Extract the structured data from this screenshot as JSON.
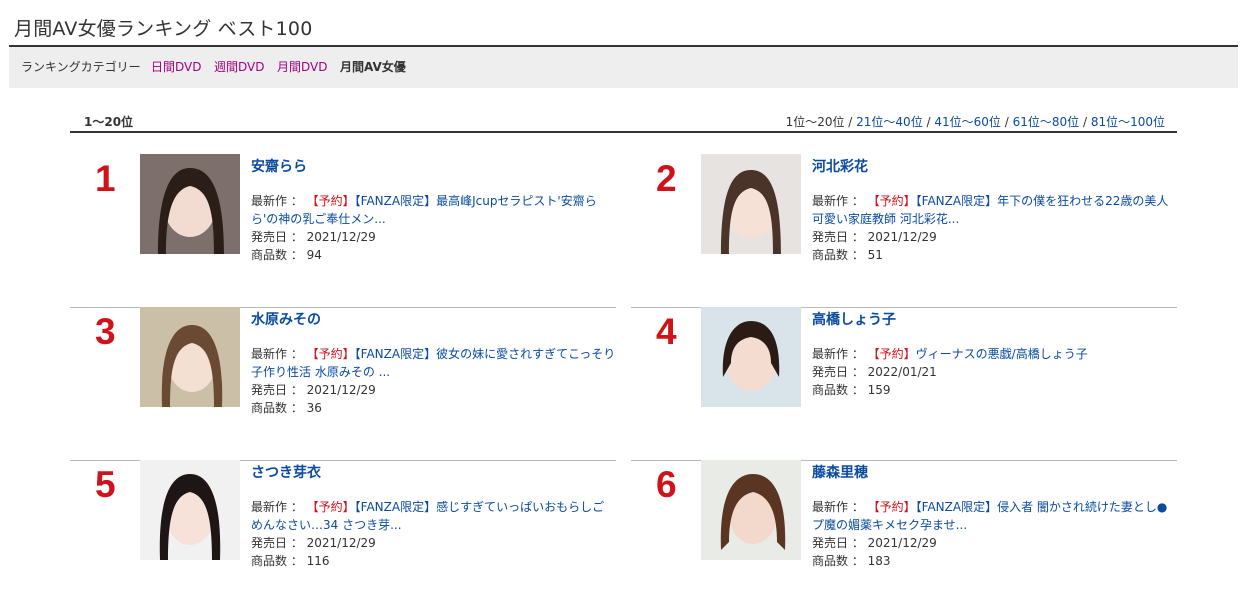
{
  "page": {
    "title": "月間AV女優ランキング ベスト100"
  },
  "categories": {
    "label": "ランキングカテゴリー",
    "links": [
      "日間DVD",
      "週間DVD",
      "月間DVD"
    ],
    "current": "月間AV女優"
  },
  "range": {
    "current": "1〜20位",
    "nav_current": "1位〜20位",
    "nav_links": [
      "21位〜40位",
      "41位〜60位",
      "61位〜80位",
      "81位〜100位"
    ],
    "separator": " / "
  },
  "labels": {
    "latest": "最新作 ： ",
    "release": "発売日 ： ",
    "count": "商品数 ： "
  },
  "ranking": [
    {
      "rank": "1",
      "name": "安齋らら",
      "reserve": "【予約】",
      "title": "【FANZA限定】最高峰Jcupセラピスト'安齋らら'の神の乳ご奉仕メン...",
      "release_date": "2021/12/29",
      "count": "94"
    },
    {
      "rank": "2",
      "name": "河北彩花",
      "reserve": "【予約】",
      "title": "【FANZA限定】年下の僕を狂わせる22歳の美人可愛い家庭教師 河北彩花...",
      "release_date": "2021/12/29",
      "count": "51"
    },
    {
      "rank": "3",
      "name": "水原みその",
      "reserve": "【予約】",
      "title": "【FANZA限定】彼女の妹に愛されすぎてこっそり子作り性活 水原みその ...",
      "release_date": "2021/12/29",
      "count": "36"
    },
    {
      "rank": "4",
      "name": "高橋しょう子",
      "reserve": "【予約】",
      "title": "ヴィーナスの悪戯/高橋しょう子",
      "release_date": "2022/01/21",
      "count": "159"
    },
    {
      "rank": "5",
      "name": "さつき芽衣",
      "reserve": "【予約】",
      "title": "【FANZA限定】感じすぎていっぱいおもらしごめんなさい…34 さつき芽...",
      "release_date": "2021/12/29",
      "count": "116"
    },
    {
      "rank": "6",
      "name": "藤森里穂",
      "reserve": "【予約】",
      "title": "【FANZA限定】侵入者 闇かされ続けた妻とし●プ魔の媚薬キメセク孕ませ...",
      "release_date": "2021/12/29",
      "count": "183"
    }
  ]
}
